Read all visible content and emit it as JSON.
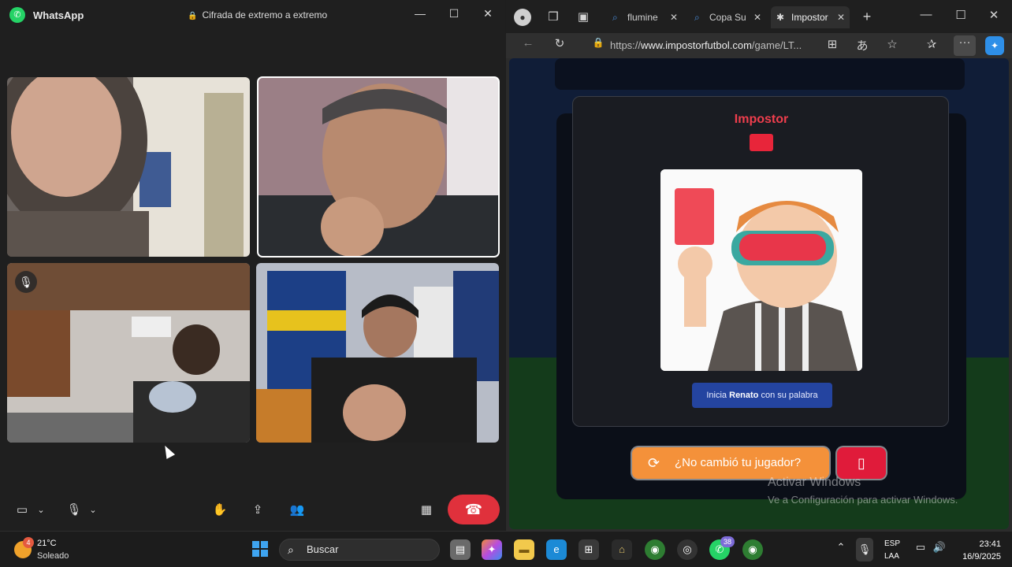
{
  "whatsapp": {
    "app_name": "WhatsApp",
    "encryption_label": "Cifrada de extremo a extremo"
  },
  "browser": {
    "tabs": [
      {
        "label": "flumine"
      },
      {
        "label": "Copa Su"
      },
      {
        "label": "Impostor"
      }
    ],
    "url_prefix": "https://",
    "url_domain": "www.impostorfutbol.com",
    "url_path": "/game/LT..."
  },
  "game": {
    "modal_title": "Impostor",
    "hint_prefix": "Inicia ",
    "hint_player": "Renato",
    "hint_suffix": " con su palabra",
    "change_button": "¿No cambió tu jugador?"
  },
  "watermark": {
    "line1": "Activar Windows",
    "line2": "Ve a Configuración para activar Windows."
  },
  "taskbar": {
    "weather_badge": "4",
    "temperature": "21°C",
    "weather": "Soleado",
    "search_placeholder": "Buscar",
    "whatsapp_badge": "38",
    "lang_primary": "ESP",
    "lang_secondary": "LAA",
    "time": "23:41",
    "date": "16/9/2025"
  },
  "colors": {
    "end_call": "#e0313c",
    "impostor_red": "#ef3e4d",
    "change_btn": "#f4913a",
    "hint_bg": "#2444a0"
  }
}
